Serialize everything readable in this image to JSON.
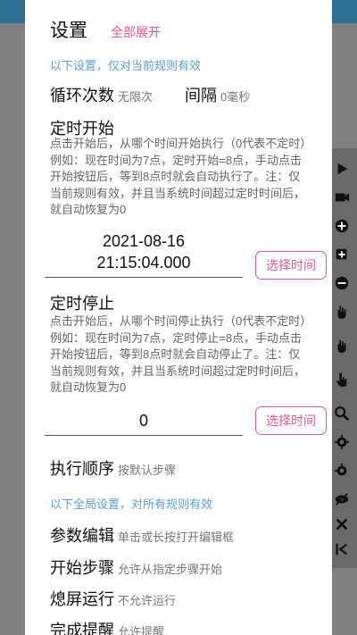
{
  "dialog": {
    "title": "设置",
    "expand_all": "全部展开"
  },
  "rule_note": "以下设置，仅对当前规则有效",
  "loop": {
    "label": "循环次数",
    "value": "无限次"
  },
  "interval": {
    "label": "间隔",
    "value": "0毫秒"
  },
  "timer_start": {
    "title": "定时开始",
    "desc": "点击开始后，从哪个时间开始执行（0代表不定时）例如：现在时间为7点，定时开始=8点，手动点击开始按钮后，等到8点时就会自动执行了。注：仅当前规则有效，并且当系统时间超过定时时间后，就自动恢复为0",
    "date": "2021-08-16",
    "time": "21:15:04.000",
    "button": "选择时间"
  },
  "timer_stop": {
    "title": "定时停止",
    "desc": "点击开始后，从哪个时间停止执行（0代表不定时）例如：现在时间为7点，定时停止=8点，手动点击开始按钮后，等到8点时就会自动停止了。注：仅当前规则有效，并且当系统时间超过定时时间后，就自动恢复为0",
    "value": "0",
    "button": "选择时间"
  },
  "exec_order": {
    "label": "执行顺序",
    "value": "按默认步骤"
  },
  "global_note": "以下全局设置，对所有规则有效",
  "param_edit": {
    "label": "参数编辑",
    "value": "单击或长按打开编辑框"
  },
  "start_step": {
    "label": "开始步骤",
    "value": "允许从指定步骤开始"
  },
  "screen_off": {
    "label": "熄屏运行",
    "value": "不允许运行"
  },
  "finish_alert": {
    "label": "完成提醒",
    "value": "允许提醒"
  },
  "toolbar_icons": [
    "play-icon",
    "camera-icon",
    "add-icon",
    "add-copy-icon",
    "remove-icon",
    "hand-icon",
    "hand-icon",
    "hand-pointer-icon",
    "search-icon",
    "gear-icon",
    "gear-alt-icon",
    "eye-off-icon",
    "close-icon",
    "collapse-icon"
  ]
}
